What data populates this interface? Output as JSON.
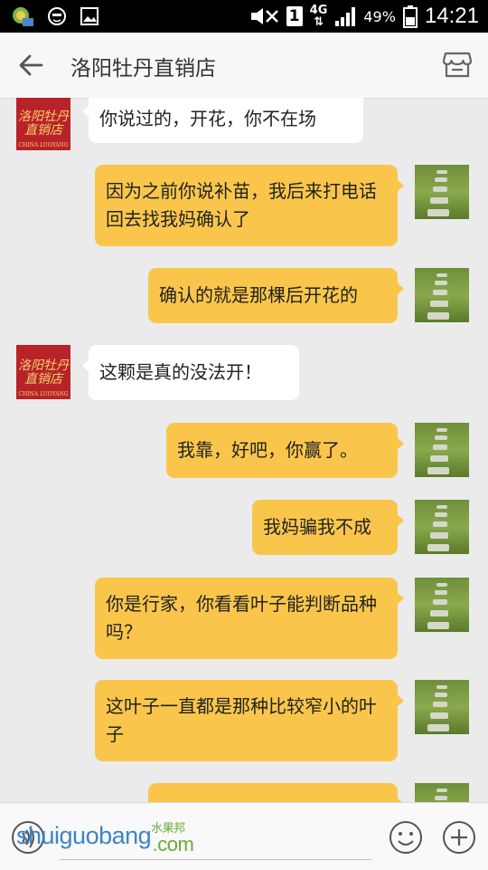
{
  "status_bar": {
    "network": "4G",
    "sim": "1",
    "battery": "49%",
    "time": "14:21"
  },
  "header": {
    "title": "洛阳牡丹直销店"
  },
  "avatar_left": {
    "logo_text": "洛阳牡丹 直销店",
    "sub_text": "CHINA LUOYANG"
  },
  "messages": [
    {
      "side": "in",
      "text": "你说过的，开花，你不在场"
    },
    {
      "side": "out",
      "text": "因为之前你说补苗，我后来打电话回去找我妈确认了"
    },
    {
      "side": "out",
      "text": "确认的就是那棵后开花的"
    },
    {
      "side": "in",
      "text": "这颗是真的没法开！"
    },
    {
      "side": "out",
      "text": "我靠，好吧，你赢了。"
    },
    {
      "side": "out",
      "text": "我妈骗我不成"
    },
    {
      "side": "out",
      "text": "你是行家，你看看叶子能判断品种吗？"
    },
    {
      "side": "out",
      "text": "这叶子一直都是那种比较窄小的叶子"
    },
    {
      "side": "out",
      "text": ""
    }
  ],
  "watermark": {
    "text": "shuiguobang",
    "cn": "水果邦",
    "suffix": ".com"
  },
  "colors": {
    "outgoing_bubble": "#f9c64b",
    "incoming_bubble": "#ffffff",
    "chat_bg": "#ebebeb"
  }
}
